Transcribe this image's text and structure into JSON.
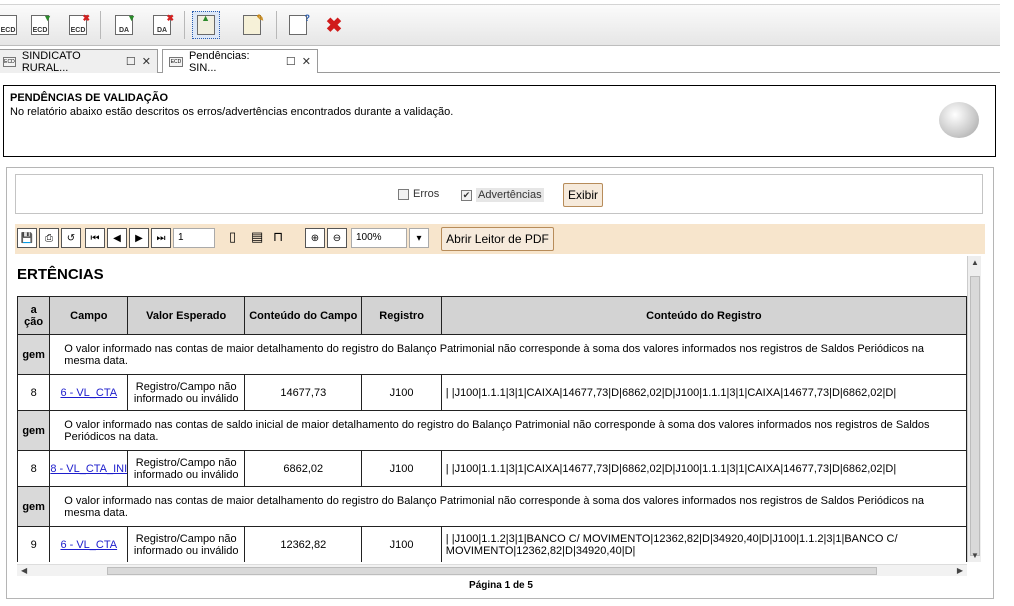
{
  "toolbar": {
    "buttons": [
      {
        "icon": "ecd-icon",
        "label": "ECD"
      },
      {
        "icon": "ecd-download-icon",
        "label": "ECD"
      },
      {
        "icon": "ecd-delete-icon",
        "label": "ECD"
      },
      {
        "icon": "da-download-icon",
        "label": "DA"
      },
      {
        "icon": "da-delete-icon",
        "label": "DA"
      },
      {
        "icon": "upload-document-icon",
        "label": ""
      },
      {
        "icon": "edit-document-icon",
        "label": ""
      },
      {
        "icon": "help-document-icon",
        "label": ""
      },
      {
        "icon": "close-x-icon",
        "label": ""
      }
    ]
  },
  "tabs": [
    {
      "label": "SINDICATO RURAL...",
      "icon": "ecd-icon"
    },
    {
      "label": "Pendências: SIN...",
      "icon": "ecd-icon"
    }
  ],
  "header": {
    "title": "PENDÊNCIAS DE VALIDAÇÃO",
    "description": "No relatório abaixo estão descritos os erros/advertências encontrados durante a validação."
  },
  "filters": {
    "erros_label": "Erros",
    "erros_checked": false,
    "advertencias_label": "Advertências",
    "advertencias_checked": true,
    "exibir_label": "Exibir"
  },
  "viewer": {
    "page_input": "1",
    "zoom": "100%",
    "pdf_button": "Abrir Leitor de PDF",
    "page_label": "Página 1 de 5"
  },
  "report": {
    "title": "ERTÊNCIAS",
    "columns": [
      "a\nção",
      "Campo",
      "Valor Esperado",
      "Conteúdo do Campo",
      "Registro",
      "Conteúdo do Registro"
    ],
    "groups": [
      {
        "tag": "gem",
        "message": "O valor informado nas contas de maior detalhamento do registro do Balanço Patrimonial não corresponde à soma dos valores informados nos registros de Saldos Periódicos na mesma data.",
        "line": "8",
        "campo": "6 - VL_CTA",
        "valor_esperado": "Registro/Campo não informado ou inválido",
        "conteudo_campo": "14677,73",
        "registro": "J100",
        "conteudo_registro": "| |J100|1.1.1|3|1|CAIXA|14677,73|D|6862,02|D|J100|1.1.1|3|1|CAIXA|14677,73|D|6862,02|D|"
      },
      {
        "tag": "gem",
        "message": "O valor informado nas contas de saldo inicial de maior detalhamento do registro do Balanço Patrimonial não corresponde à soma dos valores informados nos registros de Saldos Periódicos na data.",
        "line": "8",
        "campo": "8 - VL_CTA_INI",
        "valor_esperado": "Registro/Campo não informado ou inválido",
        "conteudo_campo": "6862,02",
        "registro": "J100",
        "conteudo_registro": "| |J100|1.1.1|3|1|CAIXA|14677,73|D|6862,02|D|J100|1.1.1|3|1|CAIXA|14677,73|D|6862,02|D|"
      },
      {
        "tag": "gem",
        "message": "O valor informado nas contas de maior detalhamento do registro do Balanço Patrimonial não corresponde à soma dos valores informados nos registros de Saldos Periódicos na mesma data.",
        "line": "9",
        "campo": "6 - VL_CTA",
        "valor_esperado": "Registro/Campo não informado ou inválido",
        "conteudo_campo": "12362,82",
        "registro": "J100",
        "conteudo_registro": "| |J100|1.1.2|3|1|BANCO C/ MOVIMENTO|12362,82|D|34920,40|D|J100|1.1.2|3|1|BANCO C/ MOVIMENTO|12362,82|D|34920,40|D|"
      }
    ]
  }
}
